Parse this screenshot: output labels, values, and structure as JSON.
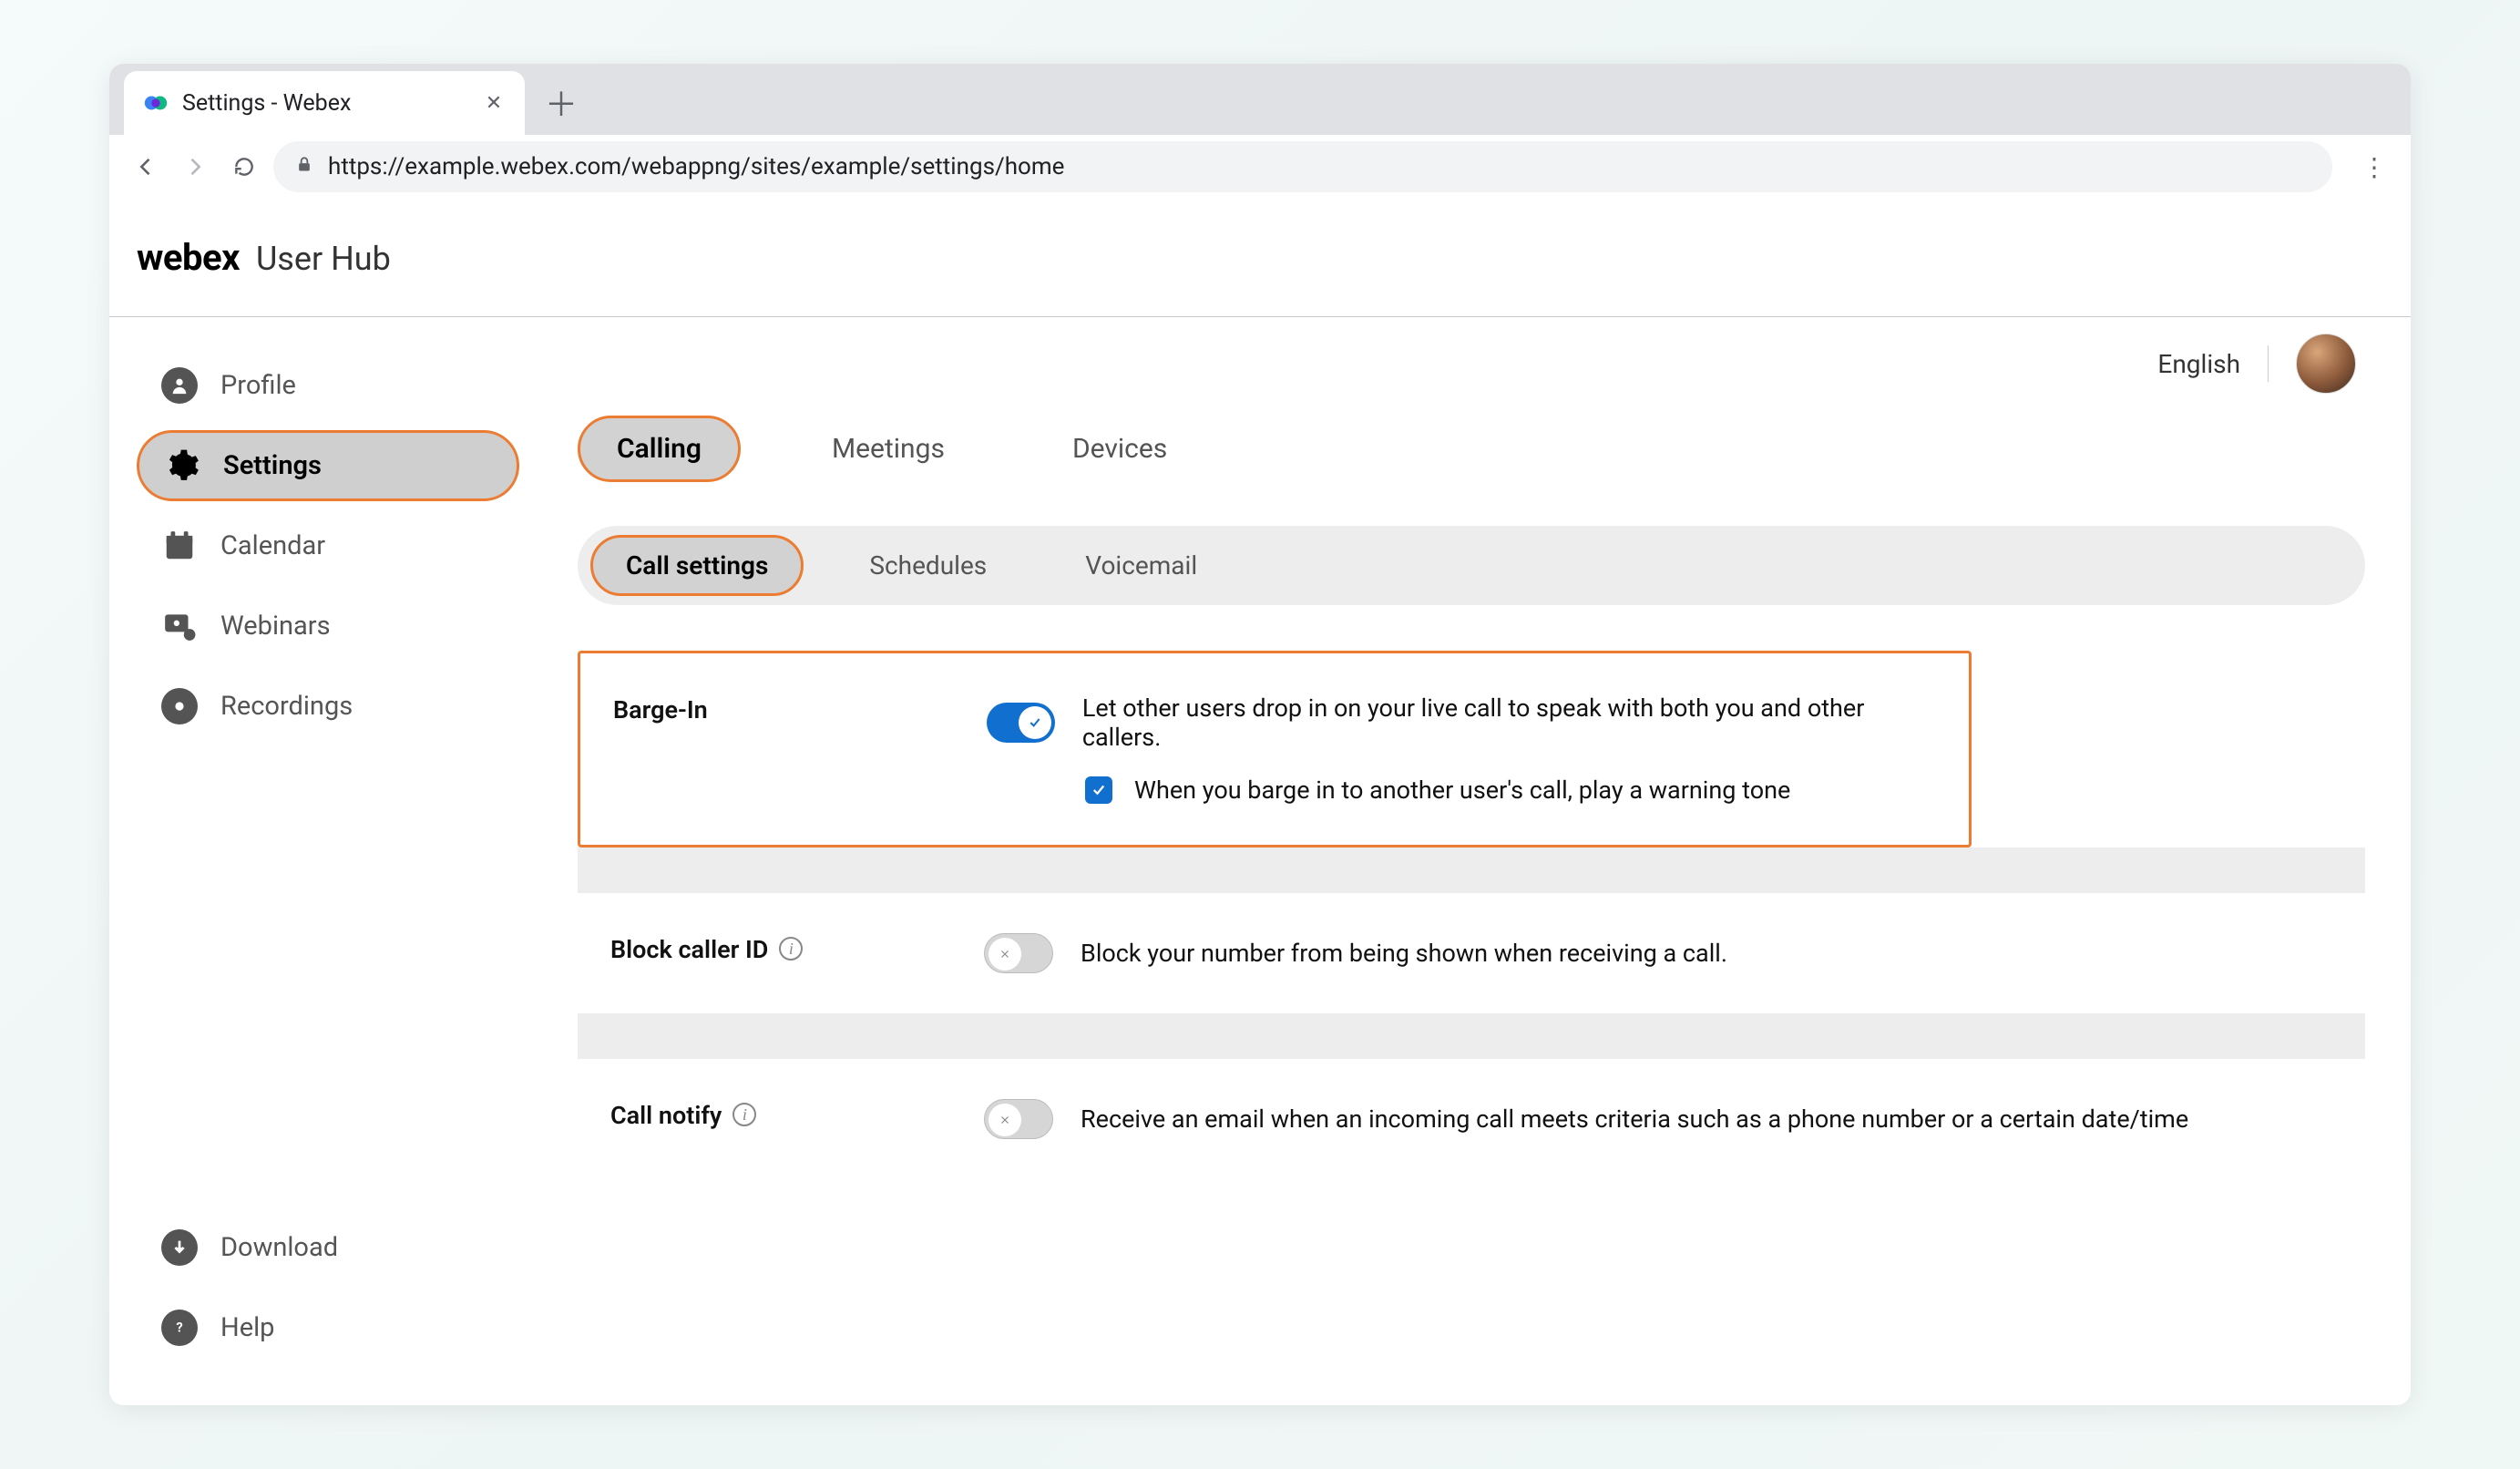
{
  "browser": {
    "tab_title": "Settings - Webex",
    "url": "https://example.webex.com/webappng/sites/example/settings/home"
  },
  "header": {
    "brand": "webex",
    "sub": "User Hub"
  },
  "top_right": {
    "language": "English"
  },
  "sidebar": {
    "items": [
      {
        "label": "Profile"
      },
      {
        "label": "Settings"
      },
      {
        "label": "Calendar"
      },
      {
        "label": "Webinars"
      },
      {
        "label": "Recordings"
      }
    ],
    "bottom": [
      {
        "label": "Download"
      },
      {
        "label": "Help"
      }
    ]
  },
  "tabs": {
    "primary": [
      {
        "label": "Calling"
      },
      {
        "label": "Meetings"
      },
      {
        "label": "Devices"
      }
    ],
    "secondary": [
      {
        "label": "Call settings"
      },
      {
        "label": "Schedules"
      },
      {
        "label": "Voicemail"
      }
    ]
  },
  "settings": {
    "barge_in": {
      "title": "Barge-In",
      "enabled": true,
      "description": "Let other users drop in on your live call to speak with both you and other callers.",
      "checkbox_label": "When you barge in to another user's call, play a warning tone",
      "checkbox_checked": true
    },
    "block_caller_id": {
      "title": "Block caller ID",
      "enabled": false,
      "description": "Block your number from being shown when receiving a call."
    },
    "call_notify": {
      "title": "Call notify",
      "enabled": false,
      "description": "Receive an email when an incoming call meets criteria such as a phone number or a certain date/time"
    }
  }
}
